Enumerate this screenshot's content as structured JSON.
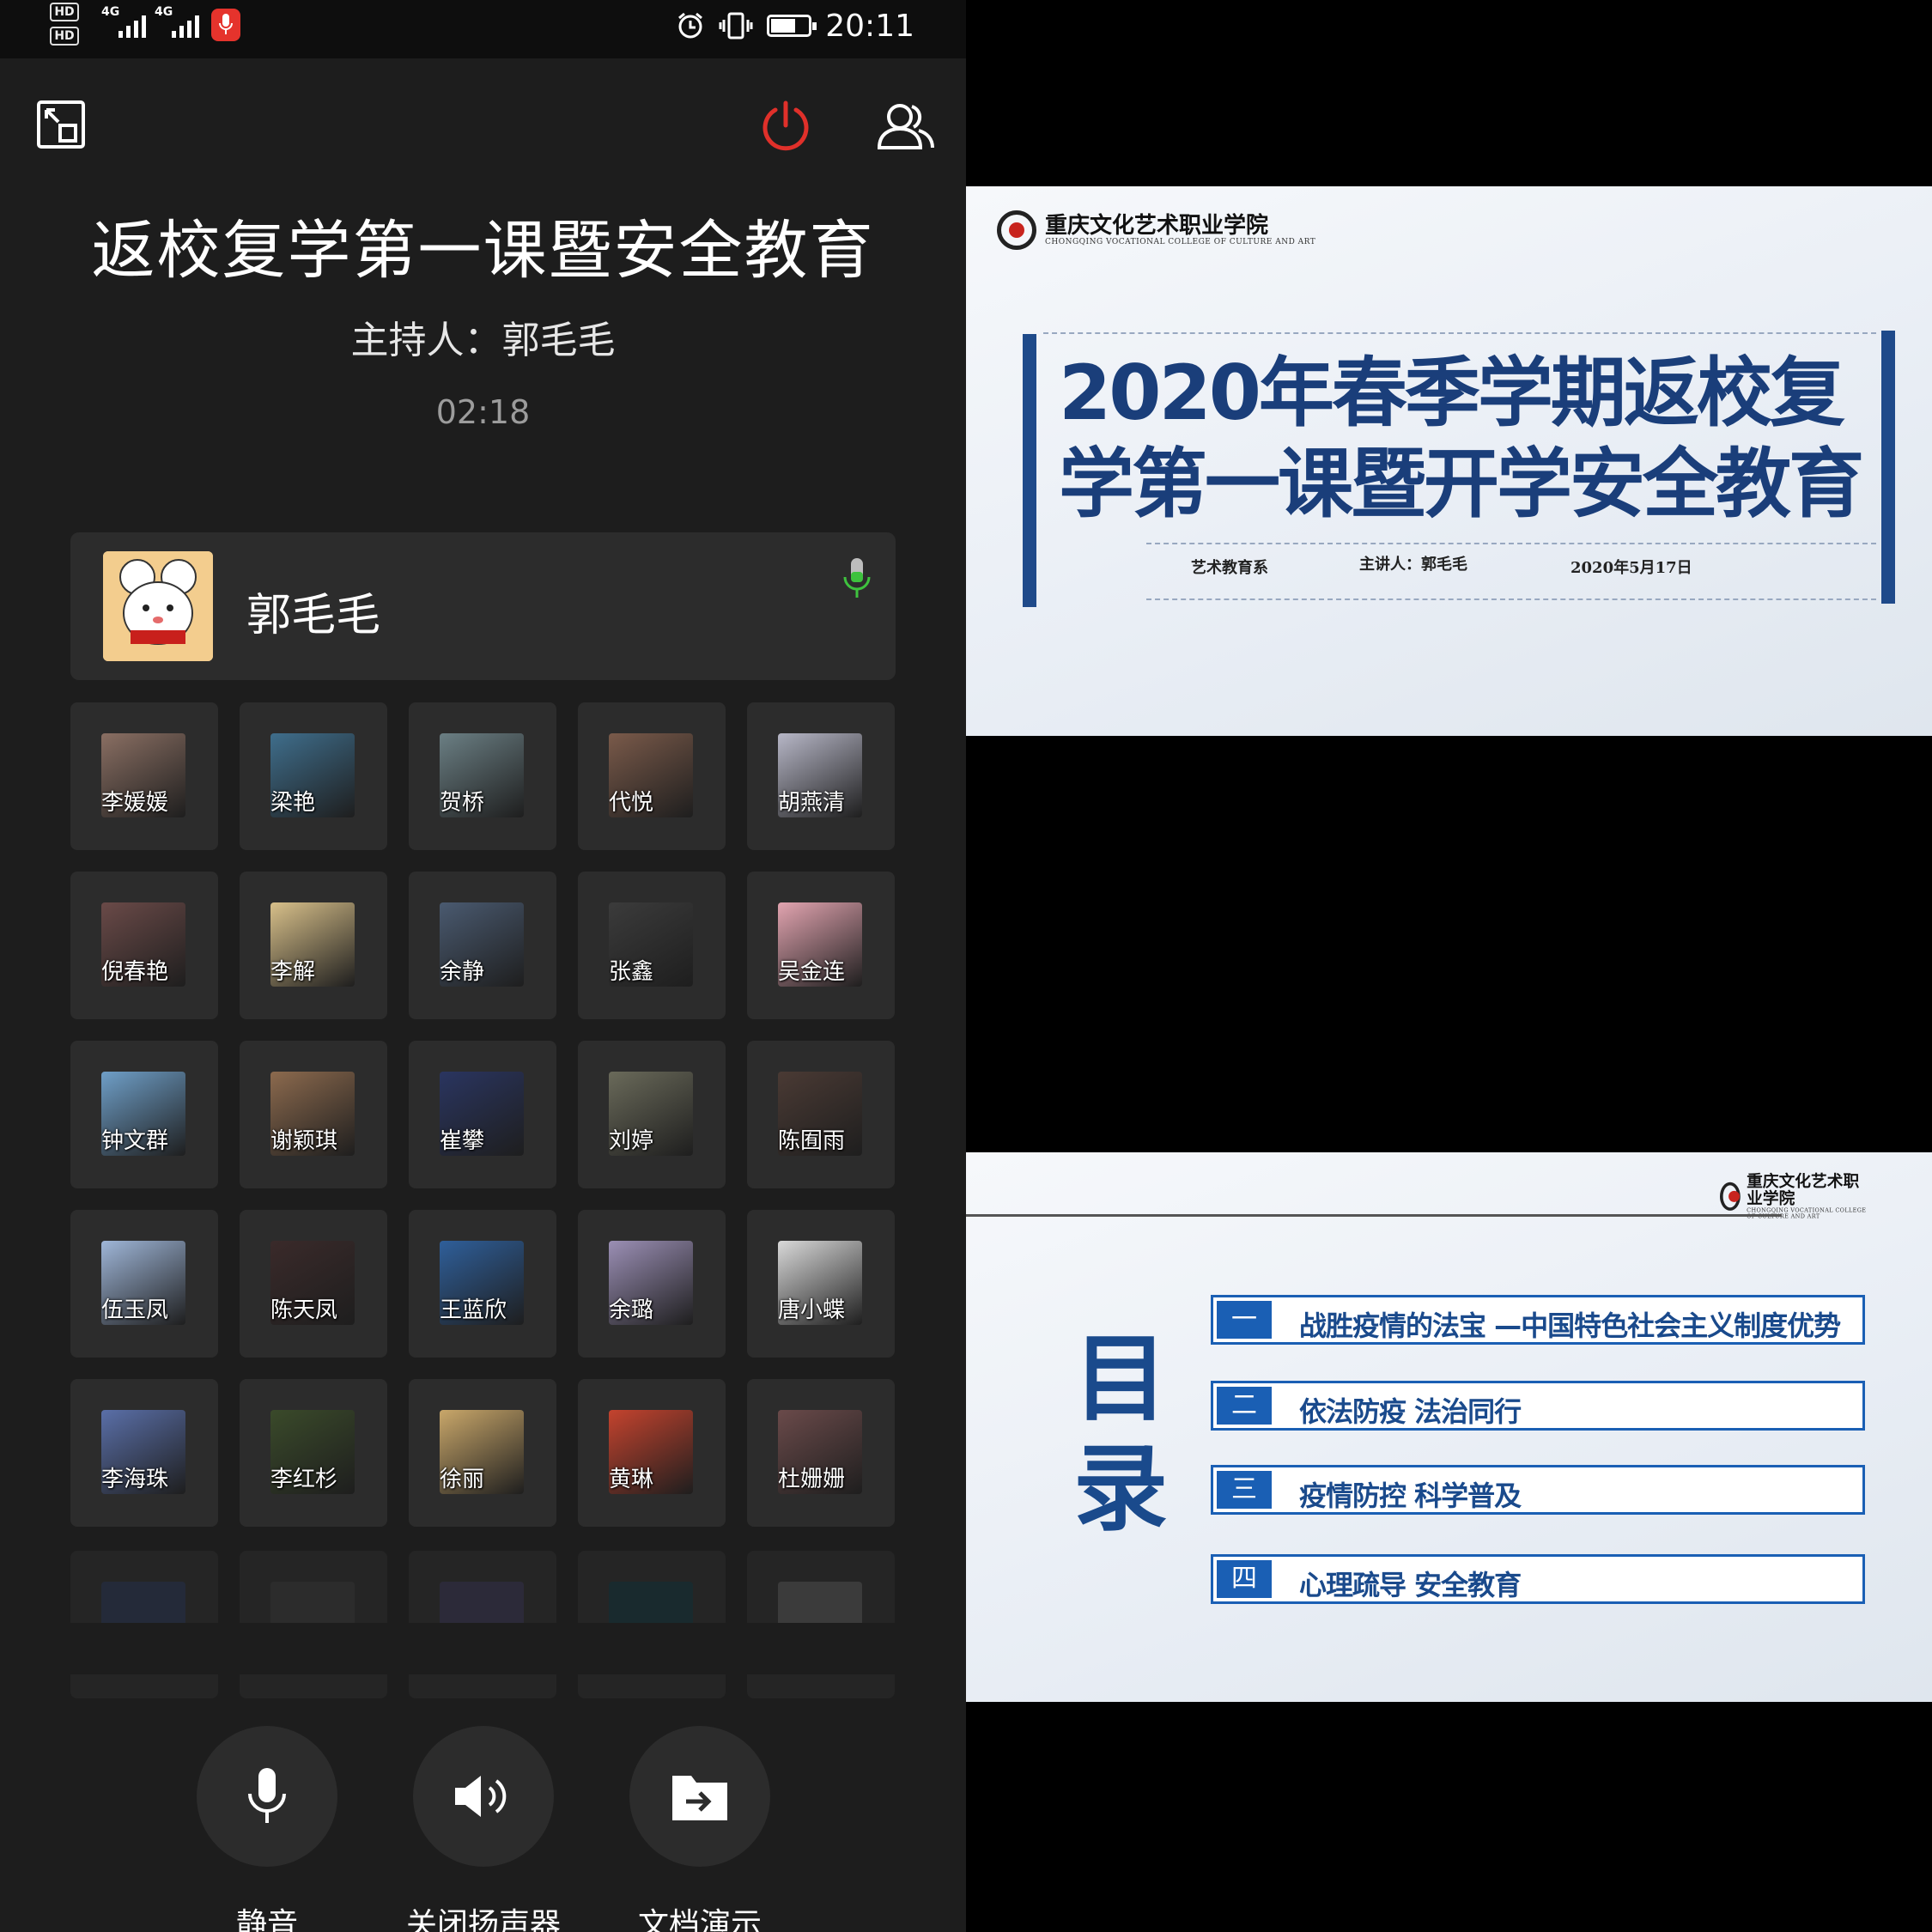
{
  "status_bar": {
    "hd1": "HD",
    "hd2": "HD",
    "net1": "4G",
    "net2": "4G",
    "time": "20:11"
  },
  "meeting": {
    "title": "返校复学第一课暨安全教育",
    "host_line": "主持人：郭毛毛",
    "timer": "02:18"
  },
  "host": {
    "name": "郭毛毛",
    "mic_color": "#3ec23e"
  },
  "participants": [
    "李媛媛",
    "梁艳",
    "贺桥",
    "代悦",
    "胡燕清",
    "倪春艳",
    "李解",
    "余静",
    "张鑫",
    "吴金连",
    "钟文群",
    "谢颖琪",
    "崔攀",
    "刘婷",
    "陈囿雨",
    "伍玉凤",
    "陈天凤",
    "王蓝欣",
    "余璐",
    "唐小蝶",
    "李海珠",
    "李红杉",
    "徐丽",
    "黄琳",
    "杜姗姗"
  ],
  "controls": {
    "mute": "静音",
    "speaker": "关闭扬声器",
    "doc": "文档演示"
  },
  "slide1": {
    "title": "2020年春季学期返校复学第一课暨开学安全教育",
    "dept": "艺术教育系",
    "speaker": "主讲人：郭毛毛",
    "date": "2020年5月17日"
  },
  "slide2": {
    "heading": "目录",
    "items": [
      {
        "num": "一",
        "text": "战胜疫情的法宝 —中国特色社会主义制度优势"
      },
      {
        "num": "二",
        "text": "依法防疫  法治同行"
      },
      {
        "num": "三",
        "text": "疫情防控  科学普及"
      },
      {
        "num": "四",
        "text": "心理疏导  安全教育"
      }
    ]
  },
  "colors": {
    "end_call": "#e0302a",
    "slide_blue": "#1a5fb4",
    "title_blue": "#1a3e7a"
  }
}
